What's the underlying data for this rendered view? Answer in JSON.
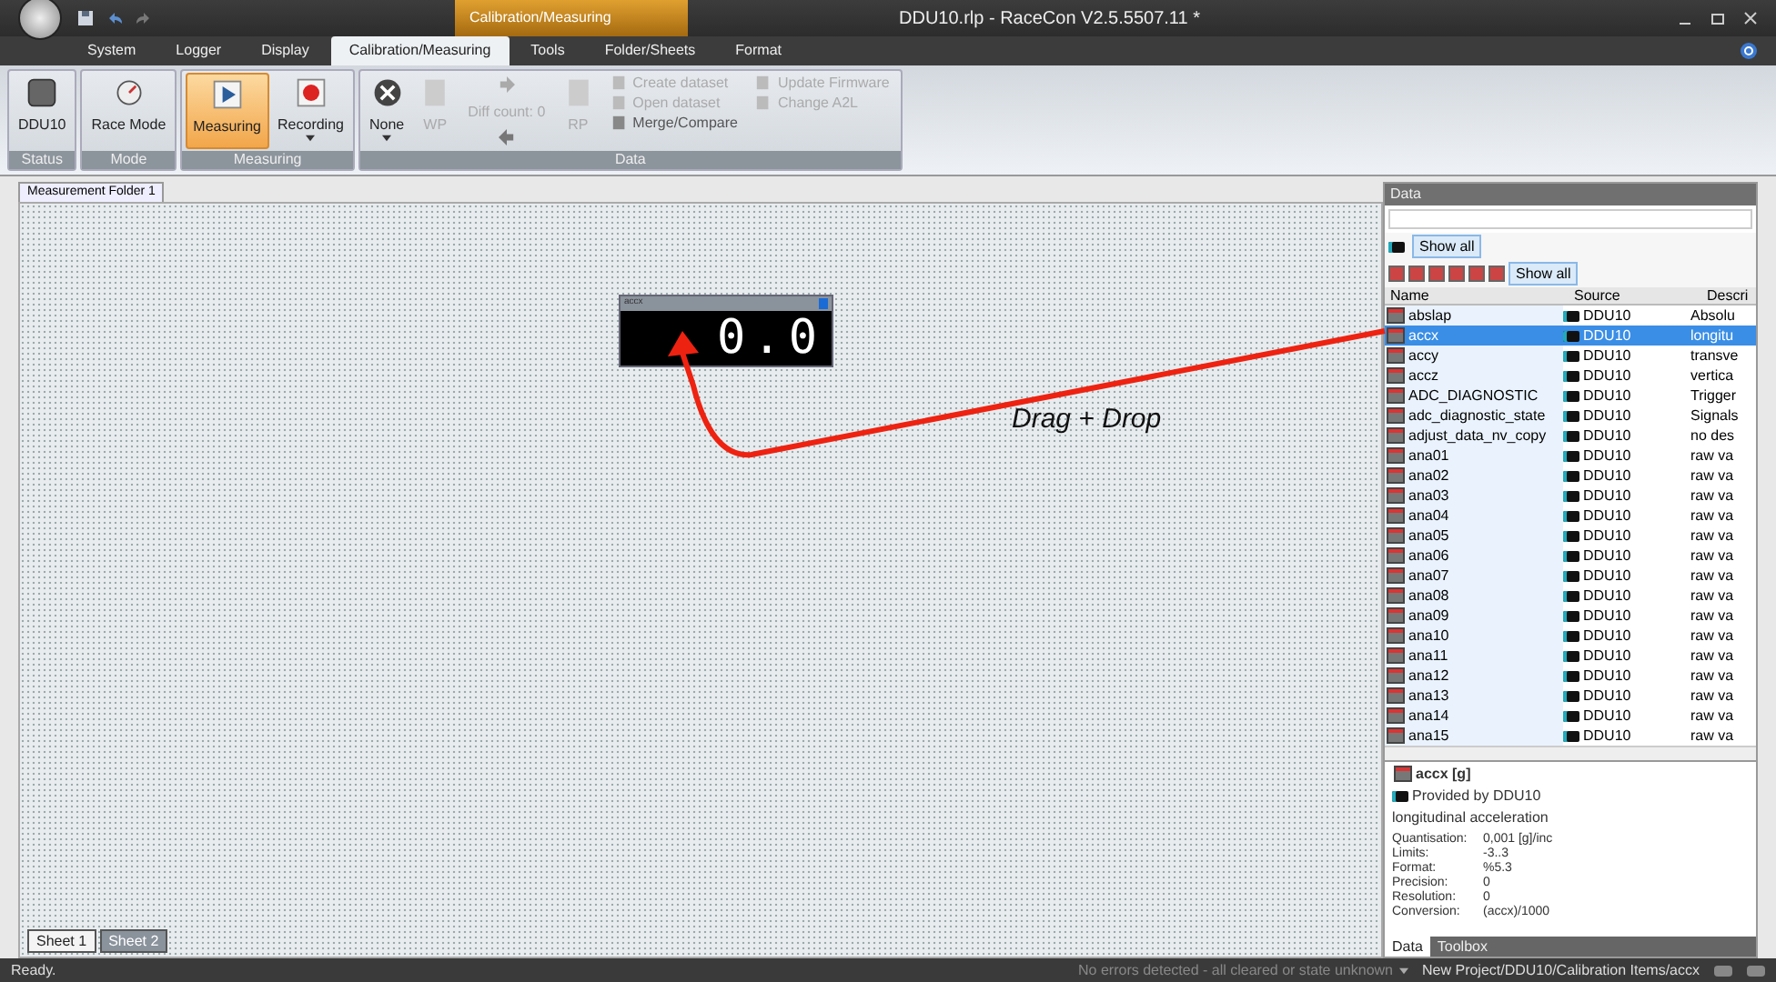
{
  "title_bar": {
    "context_tab": "Calibration/Measuring",
    "title": "DDU10.rlp - RaceCon V2.5.5507.11 *"
  },
  "ribbon_tabs": [
    {
      "label": "System",
      "selected": false
    },
    {
      "label": "Logger",
      "selected": false
    },
    {
      "label": "Display",
      "selected": false
    },
    {
      "label": "Calibration/Measuring",
      "selected": true
    },
    {
      "label": "Tools",
      "selected": false
    },
    {
      "label": "Folder/Sheets",
      "selected": false
    },
    {
      "label": "Format",
      "selected": false
    }
  ],
  "ribbon_groups": [
    {
      "label": "Status",
      "buttons": [
        {
          "label": "DDU10",
          "kind": "device",
          "selected": false,
          "disabled": false
        }
      ]
    },
    {
      "label": "Mode",
      "buttons": [
        {
          "label": "Race Mode",
          "kind": "gauge",
          "selected": false,
          "disabled": false
        }
      ]
    },
    {
      "label": "Measuring",
      "buttons": [
        {
          "label": "Measuring",
          "kind": "play",
          "selected": true,
          "disabled": false
        },
        {
          "label": "Recording",
          "kind": "record",
          "selected": false,
          "disabled": false,
          "dropdown": true
        }
      ]
    },
    {
      "label": "Data",
      "buttons": [
        {
          "label": "None",
          "kind": "none",
          "selected": false,
          "disabled": false,
          "dropdown": true
        },
        {
          "label": "WP",
          "kind": "page",
          "selected": false,
          "disabled": true
        }
      ],
      "diff_count": {
        "label": "Diff count: 0",
        "disabled": true
      },
      "after_buttons": [
        {
          "label": "RP",
          "kind": "page",
          "selected": false,
          "disabled": true
        }
      ],
      "small_items": [
        [
          {
            "label": "Create dataset",
            "disabled": true
          },
          {
            "label": "Open dataset",
            "disabled": true
          },
          {
            "label": "Merge/Compare",
            "disabled": false
          }
        ],
        [
          {
            "label": "Update Firmware",
            "disabled": true
          },
          {
            "label": "Change A2L",
            "disabled": true
          }
        ]
      ]
    }
  ],
  "document_tab": "Measurement Folder 1",
  "canvas": {
    "widget": {
      "title": "accx",
      "value": "0.0"
    },
    "annotation": "Drag + Drop"
  },
  "sheet_tabs": [
    {
      "label": "Sheet 1",
      "selected": true
    },
    {
      "label": "Sheet 2",
      "selected": false
    }
  ],
  "data_panel": {
    "title": "Data",
    "filter_row_1": "Show all",
    "filter_row_2": "Show all",
    "columns": [
      "Name",
      "Source",
      "Descri"
    ],
    "rows": [
      {
        "name": "abslap",
        "source": "DDU10",
        "description": "Absolu",
        "selected": false
      },
      {
        "name": "accx",
        "source": "DDU10",
        "description": "longitu",
        "selected": true
      },
      {
        "name": "accy",
        "source": "DDU10",
        "description": "transve",
        "selected": false
      },
      {
        "name": "accz",
        "source": "DDU10",
        "description": "vertica",
        "selected": false
      },
      {
        "name": "ADC_DIAGNOSTIC",
        "source": "DDU10",
        "description": "Trigger",
        "selected": false
      },
      {
        "name": "adc_diagnostic_state",
        "source": "DDU10",
        "description": "Signals",
        "selected": false
      },
      {
        "name": "adjust_data_nv_copy",
        "source": "DDU10",
        "description": "no des",
        "selected": false
      },
      {
        "name": "ana01",
        "source": "DDU10",
        "description": "raw va",
        "selected": false
      },
      {
        "name": "ana02",
        "source": "DDU10",
        "description": "raw va",
        "selected": false
      },
      {
        "name": "ana03",
        "source": "DDU10",
        "description": "raw va",
        "selected": false
      },
      {
        "name": "ana04",
        "source": "DDU10",
        "description": "raw va",
        "selected": false
      },
      {
        "name": "ana05",
        "source": "DDU10",
        "description": "raw va",
        "selected": false
      },
      {
        "name": "ana06",
        "source": "DDU10",
        "description": "raw va",
        "selected": false
      },
      {
        "name": "ana07",
        "source": "DDU10",
        "description": "raw va",
        "selected": false
      },
      {
        "name": "ana08",
        "source": "DDU10",
        "description": "raw va",
        "selected": false
      },
      {
        "name": "ana09",
        "source": "DDU10",
        "description": "raw va",
        "selected": false
      },
      {
        "name": "ana10",
        "source": "DDU10",
        "description": "raw va",
        "selected": false
      },
      {
        "name": "ana11",
        "source": "DDU10",
        "description": "raw va",
        "selected": false
      },
      {
        "name": "ana12",
        "source": "DDU10",
        "description": "raw va",
        "selected": false
      },
      {
        "name": "ana13",
        "source": "DDU10",
        "description": "raw va",
        "selected": false
      },
      {
        "name": "ana14",
        "source": "DDU10",
        "description": "raw va",
        "selected": false
      },
      {
        "name": "ana15",
        "source": "DDU10",
        "description": "raw va",
        "selected": false
      }
    ],
    "detail": {
      "heading": "accx [g]",
      "provider": "Provided by DDU10",
      "description": "longitudinal acceleration",
      "properties": [
        {
          "label": "Quantisation:",
          "value": "0,001 [g]/inc"
        },
        {
          "label": "Limits:",
          "value": "-3..3"
        },
        {
          "label": "Format:",
          "value": "%5.3"
        },
        {
          "label": "Precision:",
          "value": "0"
        },
        {
          "label": "Resolution:",
          "value": "0"
        },
        {
          "label": "Conversion:",
          "value": "(accx)/1000"
        }
      ]
    },
    "bottom_tabs": [
      {
        "label": "Data",
        "selected": true
      },
      {
        "label": "Toolbox",
        "selected": false
      }
    ]
  },
  "status_bar": {
    "left": "Ready.",
    "errors": "No errors detected - all cleared or state unknown",
    "path": "New Project/DDU10/Calibration Items/accx"
  }
}
